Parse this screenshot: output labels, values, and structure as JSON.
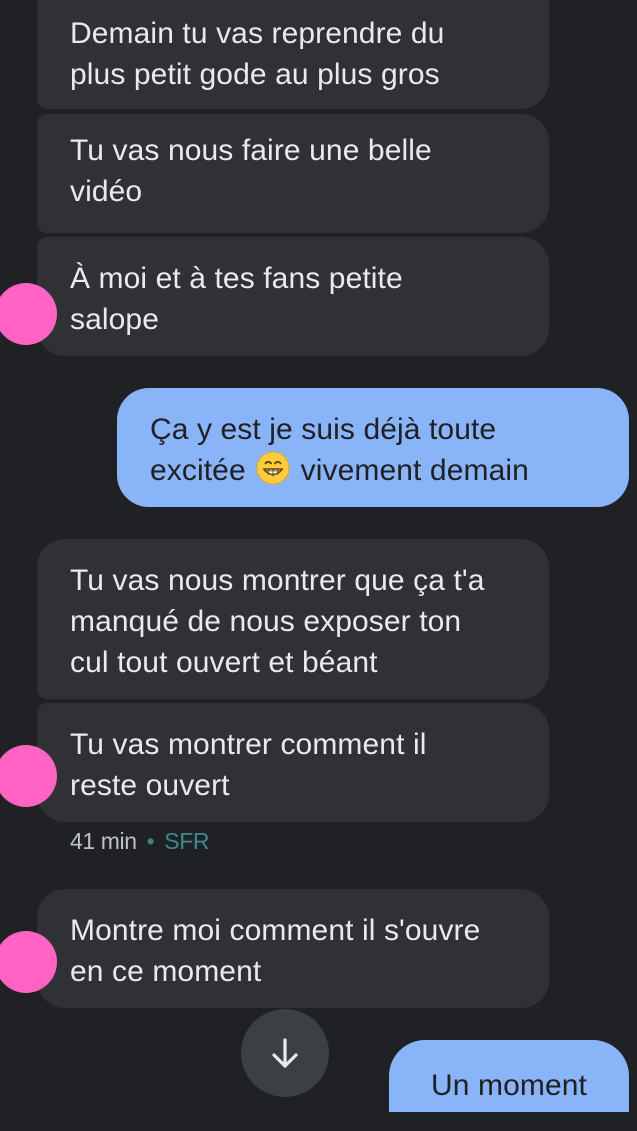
{
  "messages": [
    {
      "text_lines": [
        "Demain tu vas reprendre du",
        "plus petit gode au plus gros"
      ]
    },
    {
      "text_lines": [
        "Tu vas nous faire une belle",
        "vidéo"
      ]
    },
    {
      "text_lines": [
        "À moi et à tes fans petite",
        "salope"
      ]
    },
    {
      "line1": "Ça y est je suis déjà toute",
      "line2_a": "excitée",
      "emoji": "grinning-face-emoji",
      "line2_b": "vivement demain"
    },
    {
      "text_lines": [
        "Tu vas nous montrer que ça t'a",
        "manqué de nous exposer ton",
        "cul tout ouvert et béant"
      ]
    },
    {
      "text_lines": [
        "Tu vas montrer comment il",
        "reste ouvert"
      ]
    },
    {
      "text_lines": [
        "Montre moi comment il s'ouvre",
        "en ce moment"
      ]
    },
    {
      "text": "Un moment"
    }
  ],
  "meta": {
    "time": "41 min",
    "separator": "•",
    "carrier": "SFR"
  },
  "colors": {
    "background": "#202124",
    "incoming_bubble": "#303134",
    "outgoing_bubble": "#8ab4f8",
    "avatar": "#ff63c4"
  },
  "icons": {
    "scroll_down": "arrow-down-icon"
  }
}
